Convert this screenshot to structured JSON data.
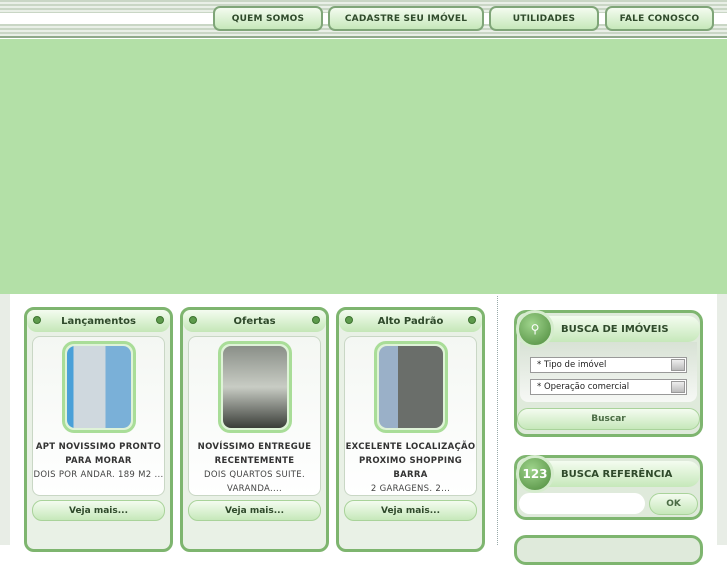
{
  "nav": [
    {
      "label": "QUEM SOMOS"
    },
    {
      "label": "CADASTRE SEU IMÓVEL"
    },
    {
      "label": "UTILIDADES"
    },
    {
      "label": "FALE CONOSCO"
    }
  ],
  "cards": [
    {
      "title": "Lançamentos",
      "headline": "APT NOVISSIMO PRONTO PARA MORAR",
      "desc": "DOIS POR ANDAR. 189 M2 ...",
      "more": "Veja mais..."
    },
    {
      "title": "Ofertas",
      "headline": "NOVÍSSIMO ENTREGUE RECENTEMENTE",
      "desc": "DOIS QUARTOS SUITE. VARANDA....",
      "more": "Veja mais..."
    },
    {
      "title": "Alto Padrão",
      "headline": "EXCELENTE LOCALIZAÇÃO PROXIMO SHOPPING BARRA",
      "desc": "2 GARAGENS. 2...",
      "more": "Veja mais..."
    }
  ],
  "busca": {
    "title": "BUSCA DE IMÓVEIS",
    "tipo": "* Tipo de imóvel",
    "operacao": "* Operação comercial",
    "button": "Buscar"
  },
  "referencia": {
    "title": "BUSCA REFERÊNCIA",
    "badge": "123",
    "input": "",
    "button": "OK"
  }
}
